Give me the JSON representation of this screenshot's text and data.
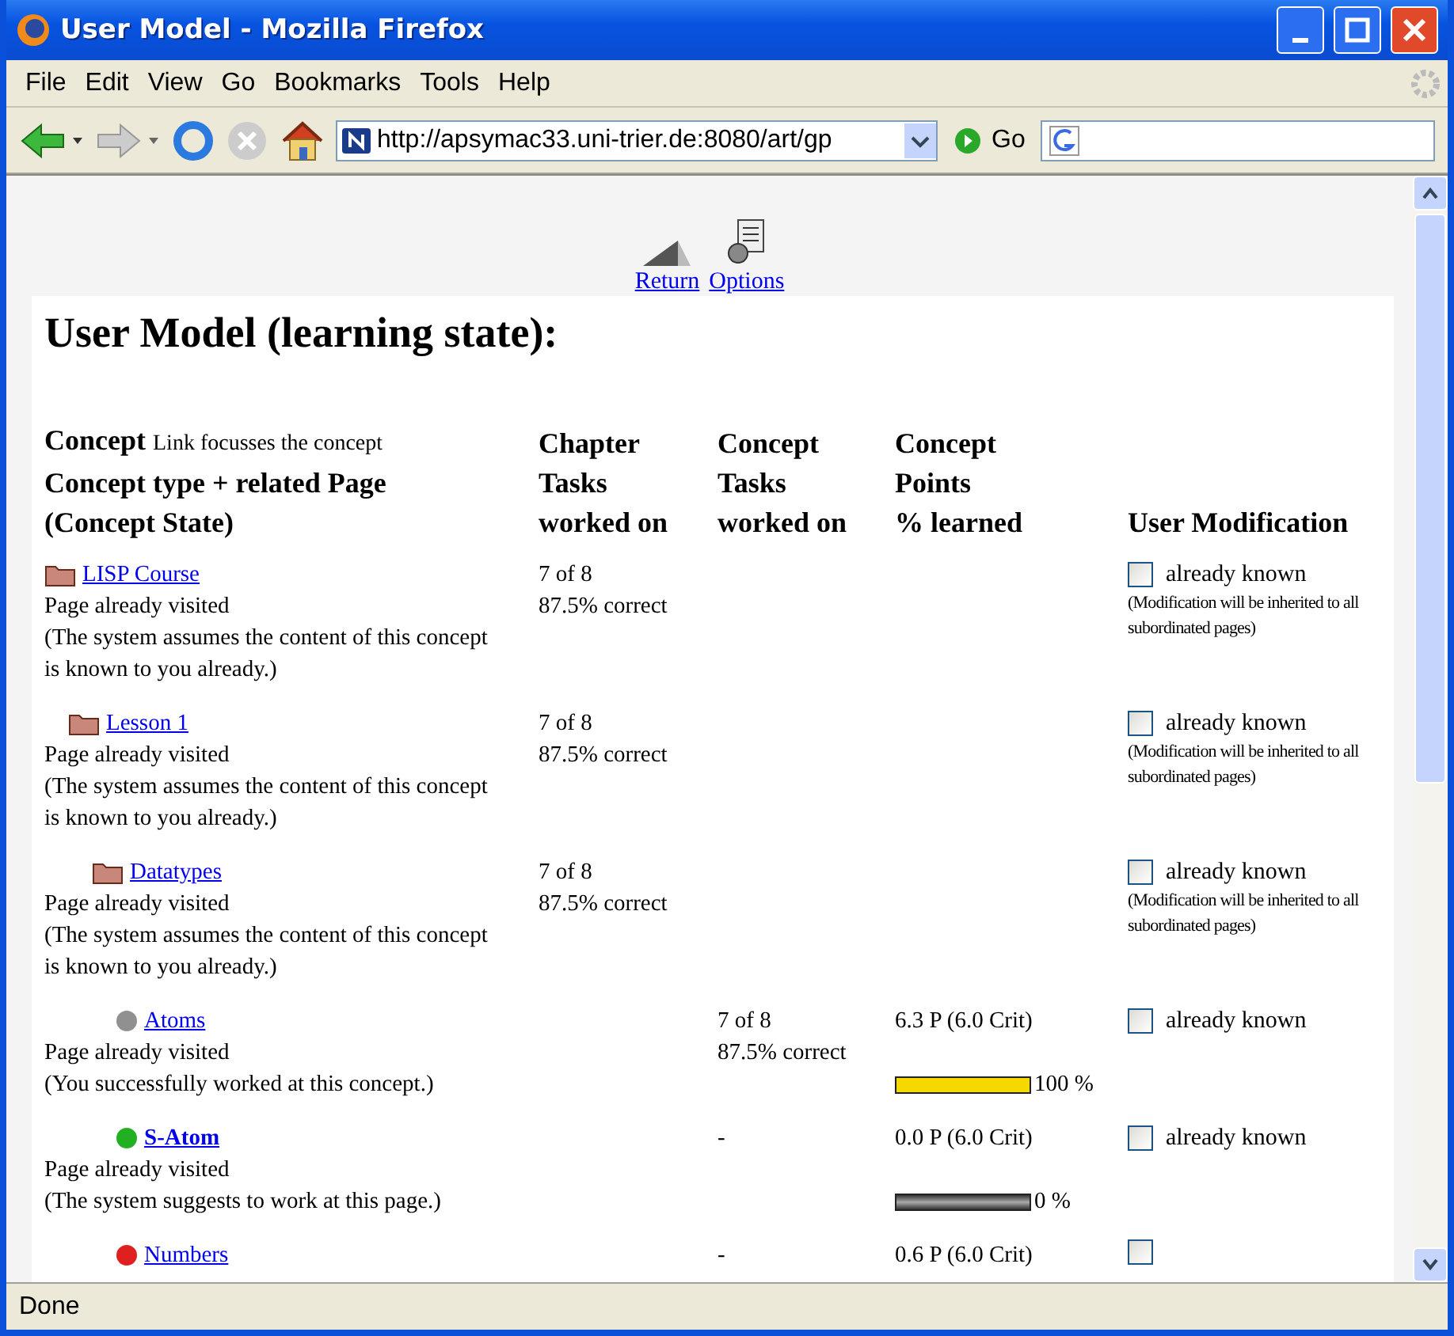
{
  "window": {
    "title": "User Model - Mozilla Firefox"
  },
  "menu": [
    {
      "label": "File"
    },
    {
      "label": "Edit"
    },
    {
      "label": "View"
    },
    {
      "label": "Go"
    },
    {
      "label": "Bookmarks"
    },
    {
      "label": "Tools"
    },
    {
      "label": "Help"
    }
  ],
  "nav": {
    "url": "http://apsymac33.uni-trier.de:8080/art/gp",
    "go": "Go"
  },
  "page_links": [
    {
      "label": "Return"
    },
    {
      "label": "Options"
    }
  ],
  "heading": "User Model (learning state):",
  "columns": [
    {
      "title": "Concept",
      "hint": "Link focusses the concept",
      "lines": [
        "Concept type + related Page",
        "(Concept State)"
      ]
    },
    {
      "lines": [
        "Chapter",
        "Tasks",
        "worked on"
      ]
    },
    {
      "lines": [
        "Concept",
        "Tasks",
        "worked on"
      ]
    },
    {
      "lines": [
        "Concept",
        "Points",
        "% learned"
      ]
    },
    {
      "lines": [
        "User Modification"
      ]
    }
  ],
  "concepts": [
    {
      "name": "LISP Course",
      "kind": "folder",
      "current": false,
      "status": "Page already visited",
      "note": "(The system assumes the content of this concept is known to you already.)",
      "chapter_tasks": [
        "7 of 8",
        "87.5% correct"
      ],
      "known": {
        "checked": false,
        "label": "already known",
        "note": "(Modification will be inherited to all subordinated pages)"
      },
      "children": [
        {
          "name": "Lesson 1",
          "kind": "folder",
          "current": false,
          "status": "Page already visited",
          "note": "(The system assumes the content of this concept is known to you already.)",
          "chapter_tasks": [
            "7 of 8",
            "87.5% correct"
          ],
          "known": {
            "checked": false,
            "label": "already known",
            "note": "(Modification will be inherited to all subordinated pages)"
          },
          "children": [
            {
              "name": "Datatypes",
              "kind": "folder",
              "current": false,
              "status": "Page already visited",
              "note": "(The system assumes the content of this concept is known to you already.)",
              "chapter_tasks": [
                "7 of 8",
                "87.5% correct"
              ],
              "known": {
                "checked": false,
                "label": "already known",
                "note": "(Modification will be inherited to all subordinated pages)"
              },
              "children": [
                {
                  "name": "Atoms",
                  "kind": "ball",
                  "color": "#909090",
                  "current": false,
                  "status": "Page already visited",
                  "note": "(You successfully worked at this concept.)",
                  "concept_tasks": [
                    "7 of 8",
                    "87.5% correct"
                  ],
                  "points": "6.3 P (6.0 Crit)",
                  "level": 1,
                  "reading": "100 %",
                  "known": {
                    "checked": false,
                    "label": "already known"
                  }
                },
                {
                  "name": "S-Atom",
                  "kind": "ball",
                  "color": "#22b022",
                  "current": true,
                  "status": "Page already visited",
                  "note": "(The system suggests to work at this page.)",
                  "concept_tasks": [
                    "-"
                  ],
                  "points": "0.0 P (6.0 Crit)",
                  "level": 0,
                  "reading": "0 %",
                  "known": {
                    "checked": false,
                    "label": "already known"
                  }
                },
                {
                  "name": "Numbers",
                  "kind": "ball",
                  "color": "#e02020",
                  "current": false,
                  "concept_tasks": [
                    "-"
                  ],
                  "points": "0.6 P (6.0 Crit)",
                  "known": {
                    "checked": false
                  }
                }
              ]
            }
          ]
        }
      ]
    }
  ],
  "status_bar": "Done"
}
